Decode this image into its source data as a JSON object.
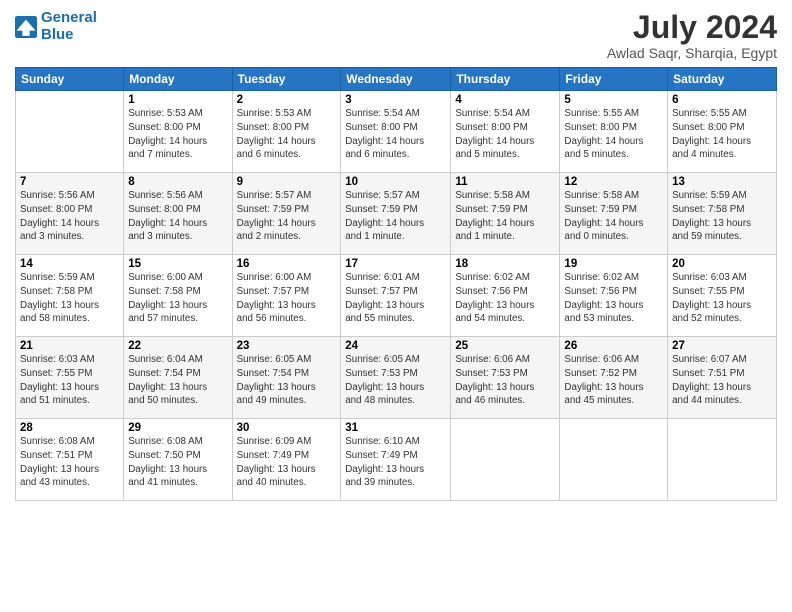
{
  "logo": {
    "line1": "General",
    "line2": "Blue"
  },
  "title": "July 2024",
  "location": "Awlad Saqr, Sharqia, Egypt",
  "days_header": [
    "Sunday",
    "Monday",
    "Tuesday",
    "Wednesday",
    "Thursday",
    "Friday",
    "Saturday"
  ],
  "weeks": [
    [
      {
        "day": "",
        "info": ""
      },
      {
        "day": "1",
        "info": "Sunrise: 5:53 AM\nSunset: 8:00 PM\nDaylight: 14 hours\nand 7 minutes."
      },
      {
        "day": "2",
        "info": "Sunrise: 5:53 AM\nSunset: 8:00 PM\nDaylight: 14 hours\nand 6 minutes."
      },
      {
        "day": "3",
        "info": "Sunrise: 5:54 AM\nSunset: 8:00 PM\nDaylight: 14 hours\nand 6 minutes."
      },
      {
        "day": "4",
        "info": "Sunrise: 5:54 AM\nSunset: 8:00 PM\nDaylight: 14 hours\nand 5 minutes."
      },
      {
        "day": "5",
        "info": "Sunrise: 5:55 AM\nSunset: 8:00 PM\nDaylight: 14 hours\nand 5 minutes."
      },
      {
        "day": "6",
        "info": "Sunrise: 5:55 AM\nSunset: 8:00 PM\nDaylight: 14 hours\nand 4 minutes."
      }
    ],
    [
      {
        "day": "7",
        "info": "Sunrise: 5:56 AM\nSunset: 8:00 PM\nDaylight: 14 hours\nand 3 minutes."
      },
      {
        "day": "8",
        "info": "Sunrise: 5:56 AM\nSunset: 8:00 PM\nDaylight: 14 hours\nand 3 minutes."
      },
      {
        "day": "9",
        "info": "Sunrise: 5:57 AM\nSunset: 7:59 PM\nDaylight: 14 hours\nand 2 minutes."
      },
      {
        "day": "10",
        "info": "Sunrise: 5:57 AM\nSunset: 7:59 PM\nDaylight: 14 hours\nand 1 minute."
      },
      {
        "day": "11",
        "info": "Sunrise: 5:58 AM\nSunset: 7:59 PM\nDaylight: 14 hours\nand 1 minute."
      },
      {
        "day": "12",
        "info": "Sunrise: 5:58 AM\nSunset: 7:59 PM\nDaylight: 14 hours\nand 0 minutes."
      },
      {
        "day": "13",
        "info": "Sunrise: 5:59 AM\nSunset: 7:58 PM\nDaylight: 13 hours\nand 59 minutes."
      }
    ],
    [
      {
        "day": "14",
        "info": "Sunrise: 5:59 AM\nSunset: 7:58 PM\nDaylight: 13 hours\nand 58 minutes."
      },
      {
        "day": "15",
        "info": "Sunrise: 6:00 AM\nSunset: 7:58 PM\nDaylight: 13 hours\nand 57 minutes."
      },
      {
        "day": "16",
        "info": "Sunrise: 6:00 AM\nSunset: 7:57 PM\nDaylight: 13 hours\nand 56 minutes."
      },
      {
        "day": "17",
        "info": "Sunrise: 6:01 AM\nSunset: 7:57 PM\nDaylight: 13 hours\nand 55 minutes."
      },
      {
        "day": "18",
        "info": "Sunrise: 6:02 AM\nSunset: 7:56 PM\nDaylight: 13 hours\nand 54 minutes."
      },
      {
        "day": "19",
        "info": "Sunrise: 6:02 AM\nSunset: 7:56 PM\nDaylight: 13 hours\nand 53 minutes."
      },
      {
        "day": "20",
        "info": "Sunrise: 6:03 AM\nSunset: 7:55 PM\nDaylight: 13 hours\nand 52 minutes."
      }
    ],
    [
      {
        "day": "21",
        "info": "Sunrise: 6:03 AM\nSunset: 7:55 PM\nDaylight: 13 hours\nand 51 minutes."
      },
      {
        "day": "22",
        "info": "Sunrise: 6:04 AM\nSunset: 7:54 PM\nDaylight: 13 hours\nand 50 minutes."
      },
      {
        "day": "23",
        "info": "Sunrise: 6:05 AM\nSunset: 7:54 PM\nDaylight: 13 hours\nand 49 minutes."
      },
      {
        "day": "24",
        "info": "Sunrise: 6:05 AM\nSunset: 7:53 PM\nDaylight: 13 hours\nand 48 minutes."
      },
      {
        "day": "25",
        "info": "Sunrise: 6:06 AM\nSunset: 7:53 PM\nDaylight: 13 hours\nand 46 minutes."
      },
      {
        "day": "26",
        "info": "Sunrise: 6:06 AM\nSunset: 7:52 PM\nDaylight: 13 hours\nand 45 minutes."
      },
      {
        "day": "27",
        "info": "Sunrise: 6:07 AM\nSunset: 7:51 PM\nDaylight: 13 hours\nand 44 minutes."
      }
    ],
    [
      {
        "day": "28",
        "info": "Sunrise: 6:08 AM\nSunset: 7:51 PM\nDaylight: 13 hours\nand 43 minutes."
      },
      {
        "day": "29",
        "info": "Sunrise: 6:08 AM\nSunset: 7:50 PM\nDaylight: 13 hours\nand 41 minutes."
      },
      {
        "day": "30",
        "info": "Sunrise: 6:09 AM\nSunset: 7:49 PM\nDaylight: 13 hours\nand 40 minutes."
      },
      {
        "day": "31",
        "info": "Sunrise: 6:10 AM\nSunset: 7:49 PM\nDaylight: 13 hours\nand 39 minutes."
      },
      {
        "day": "",
        "info": ""
      },
      {
        "day": "",
        "info": ""
      },
      {
        "day": "",
        "info": ""
      }
    ]
  ]
}
